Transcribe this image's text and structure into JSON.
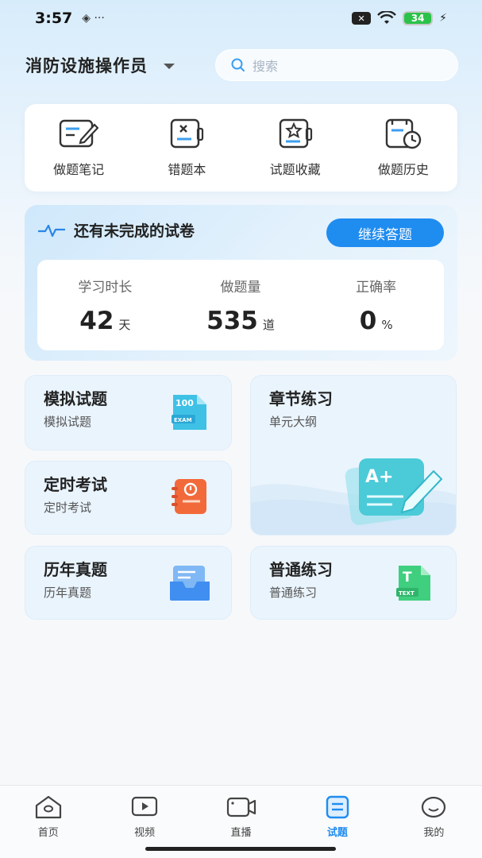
{
  "status_bar": {
    "time": "3:57",
    "left_icons": "◈ ···",
    "sim_label": "✕",
    "battery": "34"
  },
  "header": {
    "title": "消防设施操作员",
    "search_placeholder": "搜索"
  },
  "quick_links": [
    {
      "label": "做题笔记",
      "icon": "note-edit-icon"
    },
    {
      "label": "错题本",
      "icon": "wrong-book-icon"
    },
    {
      "label": "试题收藏",
      "icon": "star-collect-icon"
    },
    {
      "label": "做题历史",
      "icon": "history-clock-icon"
    }
  ],
  "progress": {
    "title": "还有未完成的试卷",
    "continue_label": "继续答题",
    "stats": [
      {
        "label": "学习时长",
        "value": "42",
        "unit": "天"
      },
      {
        "label": "做题量",
        "value": "535",
        "unit": "道"
      },
      {
        "label": "正确率",
        "value": "0",
        "unit": "%"
      }
    ]
  },
  "tiles": {
    "mock": {
      "title": "模拟试题",
      "sub": "模拟试题",
      "icon_text": "100",
      "icon_tag": "EXAM"
    },
    "chapter": {
      "title": "章节练习",
      "sub": "单元大纲",
      "icon_text": "A+"
    },
    "timed": {
      "title": "定时考试",
      "sub": "定时考试"
    },
    "past": {
      "title": "历年真题",
      "sub": "历年真题"
    },
    "normal": {
      "title": "普通练习",
      "sub": "普通练习",
      "icon_text": "T",
      "icon_tag": "TEXT"
    }
  },
  "tabbar": [
    {
      "label": "首页",
      "icon": "home-icon",
      "active": false
    },
    {
      "label": "视频",
      "icon": "video-icon",
      "active": false
    },
    {
      "label": "直播",
      "icon": "live-camera-icon",
      "active": false
    },
    {
      "label": "试题",
      "icon": "exam-list-icon",
      "active": true
    },
    {
      "label": "我的",
      "icon": "profile-smile-icon",
      "active": false
    }
  ],
  "colors": {
    "accent": "#1f8cf0",
    "tile_bg": "#eaf4fd"
  }
}
